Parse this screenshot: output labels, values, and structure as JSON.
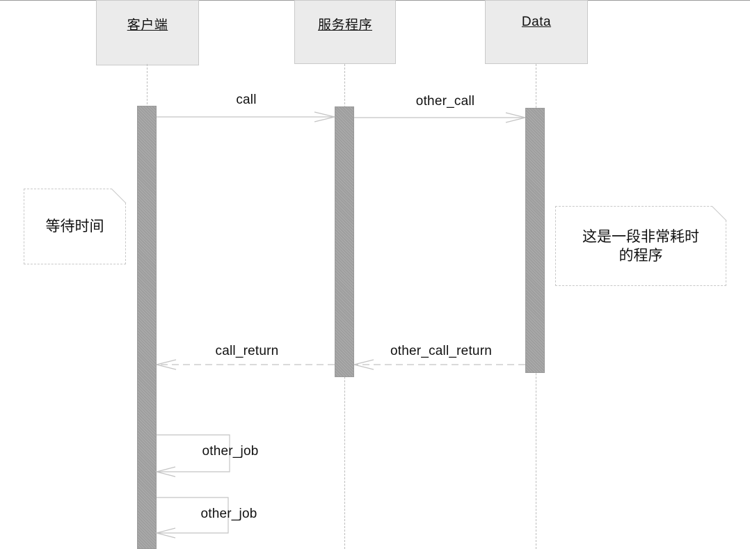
{
  "participants": {
    "client": "客户端",
    "server": "服务程序",
    "data": "Data"
  },
  "messages": {
    "call": "call",
    "other_call": "other_call",
    "call_return": "call_return",
    "other_call_return": "other_call_return",
    "other_job_1": "other_job",
    "other_job_2": "other_job"
  },
  "notes": {
    "wait": "等待时间",
    "slow_line1": "这是一段非常耗时",
    "slow_line2": "的程序"
  }
}
